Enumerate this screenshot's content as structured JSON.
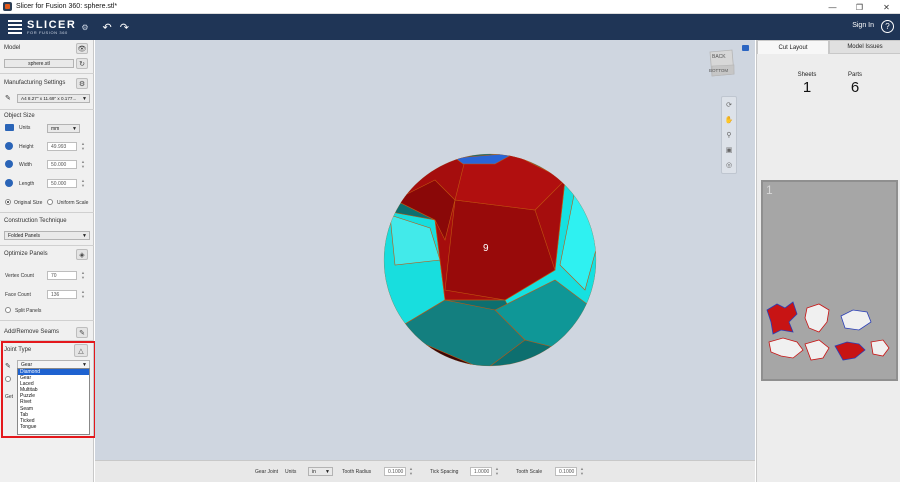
{
  "window": {
    "title": "Slicer for Fusion 360: sphere.stl*",
    "controls": [
      "minimize-icon",
      "restore-icon",
      "close-icon"
    ]
  },
  "appbar": {
    "brand": "SLICER",
    "brand_sub": "FOR FUSION 360",
    "signin": "Sign In",
    "help": "?"
  },
  "left": {
    "model": {
      "title": "Model",
      "file": "sphere.stl"
    },
    "manufacturing": {
      "title": "Manufacturing Settings",
      "paper": "A4 8.27\" x 11.69\" x 0.177..."
    },
    "object_size": {
      "title": "Object Size",
      "units_label": "Units",
      "units_value": "mm",
      "height_label": "Height",
      "height_value": "49.993",
      "width_label": "Width",
      "width_value": "50.000",
      "length_label": "Length",
      "length_value": "50.000",
      "original_size": "Original Size",
      "uniform_scale": "Uniform Scale"
    },
    "construction": {
      "title": "Construction Technique",
      "value": "Folded Panels"
    },
    "optimize": {
      "title": "Optimize Panels",
      "vertex_label": "Vertex Count",
      "vertex_value": "70",
      "face_label": "Face Count",
      "face_value": "136",
      "split_panels": "Split Panels"
    },
    "seams": {
      "title": "Add/Remove Seams"
    },
    "joint": {
      "title": "Joint Type",
      "selected": "Gear",
      "options": [
        "Diamond",
        "Gear",
        "Laced",
        "Multitab",
        "Puzzle",
        "Rivet",
        "Seam",
        "Tab",
        "Ticked",
        "Tongue"
      ],
      "highlighted_index": 0,
      "partial_label": "Get"
    }
  },
  "viewport": {
    "viewcube_top": "BACK",
    "viewcube_bottom": "BOTTOM",
    "face_label": "9"
  },
  "bottombar": {
    "joint_label": "Gear Joint",
    "units_label": "Units",
    "units_value": "in",
    "tooth_radius_label": "Tooth Radius",
    "tooth_radius_value": "0.1000",
    "tick_spacing_label": "Tick Spacing",
    "tick_spacing_value": "1.0000",
    "tooth_scale_label": "Tooth Scale",
    "tooth_scale_value": "0.1000"
  },
  "right": {
    "tabs": [
      "Cut Layout",
      "Model Issues"
    ],
    "sheets_label": "Sheets",
    "sheets_value": "1",
    "parts_label": "Parts",
    "parts_value": "6",
    "sheet_number": "1"
  },
  "colors": {
    "appbar": "#1f3556",
    "highlight": "#e4181c",
    "select": "#1e62d0",
    "model_red": "#a50d0d",
    "model_cyan": "#12dcdc"
  }
}
